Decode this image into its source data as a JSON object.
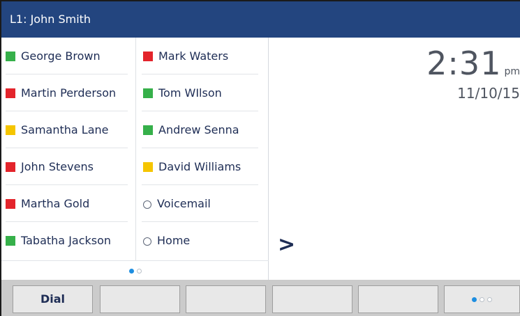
{
  "header": {
    "title": "L1: John Smith"
  },
  "contacts_left": [
    {
      "name": "George Brown",
      "status_color": "#36b04a"
    },
    {
      "name": "Martin Perderson",
      "status_color": "#e3242b"
    },
    {
      "name": "Samantha Lane",
      "status_color": "#f5c500"
    },
    {
      "name": "John Stevens",
      "status_color": "#e3242b"
    },
    {
      "name": "Martha Gold",
      "status_color": "#e3242b"
    },
    {
      "name": "Tabatha Jackson",
      "status_color": "#36b04a"
    }
  ],
  "contacts_right": [
    {
      "name": "Mark Waters",
      "status_color": "#e3242b"
    },
    {
      "name": "Tom WIlson",
      "status_color": "#36b04a"
    },
    {
      "name": "Andrew Senna",
      "status_color": "#36b04a"
    },
    {
      "name": "David Williams",
      "status_color": "#f5c500"
    },
    {
      "name": "Voicemail",
      "icon": "circle-icon"
    },
    {
      "name": "Home",
      "icon": "circle-icon"
    }
  ],
  "page_indicator": {
    "current": 1,
    "total": 2
  },
  "more_arrow": ">",
  "clock": {
    "time": "2:31",
    "ampm": "pm",
    "date": "11/10/15"
  },
  "softkeys": [
    {
      "label": "Dial"
    },
    {
      "label": ""
    },
    {
      "label": ""
    },
    {
      "label": ""
    },
    {
      "label": ""
    },
    {
      "label": ""
    }
  ],
  "softkey_page_indicator": {
    "current": 1,
    "total": 3
  }
}
